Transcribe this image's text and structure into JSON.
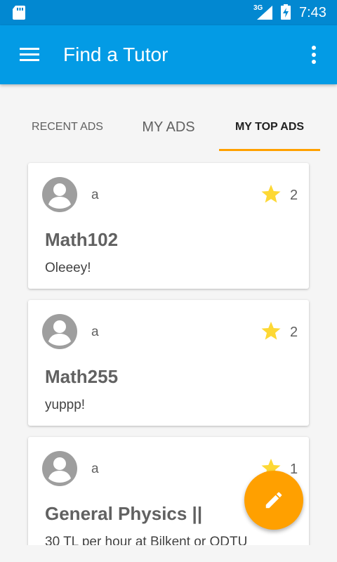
{
  "status_bar": {
    "network_type": "3G",
    "time": "7:43",
    "icons": [
      "sd-card-icon",
      "signal-icon",
      "battery-charging-icon"
    ]
  },
  "app_bar": {
    "title": "Find a Tutor",
    "icons": [
      "menu-icon",
      "overflow-menu-icon"
    ]
  },
  "tabs": [
    {
      "label": "RECENT ADS",
      "selected": false
    },
    {
      "label": "MY ADS",
      "selected": false
    },
    {
      "label": "MY TOP ADS",
      "selected": true
    }
  ],
  "ads": [
    {
      "author": "a",
      "stars": "2",
      "course": "Math102",
      "description": "Oleeey!"
    },
    {
      "author": "a",
      "stars": "2",
      "course": "Math255",
      "description": "yuppp!"
    },
    {
      "author": "a",
      "stars": "1",
      "course": "General Physics ||",
      "description": "30 TL per hour at Bilkent or ODTU"
    }
  ],
  "fab": {
    "icon": "edit-pencil-icon"
  },
  "colors": {
    "status_bar": "#0288d1",
    "app_bar": "#039be5",
    "accent": "#ffa000",
    "star": "#fdd835",
    "avatar": "#9e9e9e"
  }
}
